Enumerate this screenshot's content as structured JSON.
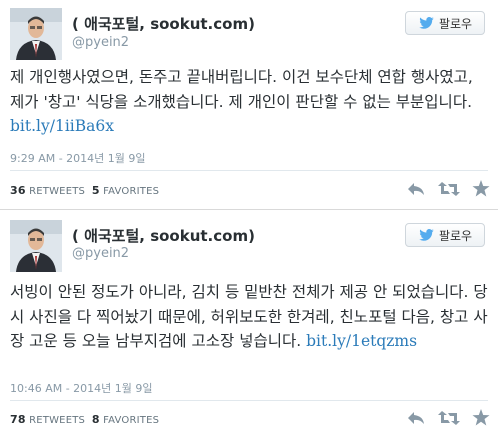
{
  "tweets": [
    {
      "name": "( 애국포털, sookut.com)",
      "handle": "@pyein2",
      "follow_label": "팔로우",
      "text": "제 개인행사였으면, 돈주고 끝내버립니다. 이건 보수단체 연합 행사였고, 제가 '창고' 식당을 소개했습니다. 제 개인이 판단할 수 없는 부분입니다. ",
      "link": "bit.ly/1iiBa6x",
      "timestamp": "9:29 AM - 2014년 1월 9일",
      "retweets_count": "36",
      "retweets_label": "RETWEETS",
      "favorites_count": "5",
      "favorites_label": "FAVORITES"
    },
    {
      "name": "( 애국포털, sookut.com)",
      "handle": "@pyein2",
      "follow_label": "팔로우",
      "text": "서빙이 안된 정도가 아니라, 김치 등 밑반찬 전체가 제공 안 되었습니다. 당시 사진을 다 찍어놨기 때문에, 허위보도한 한겨레, 친노포털 다음, 창고 사장 고운 등 오늘 남부지검에 고소장 넣습니다. ",
      "link": "bit.ly/1etqzms",
      "timestamp": "10:46 AM - 2014년 1월 9일",
      "retweets_count": "78",
      "retweets_label": "RETWEETS",
      "favorites_count": "8",
      "favorites_label": "FAVORITES"
    }
  ],
  "icons": {
    "bird": "twitter-bird-icon",
    "reply": "reply-icon",
    "retweet": "retweet-icon",
    "favorite": "star-icon"
  },
  "colors": {
    "link": "#2b7bb9",
    "bird": "#55acee",
    "muted": "#8899a6",
    "icon": "#8899a6"
  }
}
